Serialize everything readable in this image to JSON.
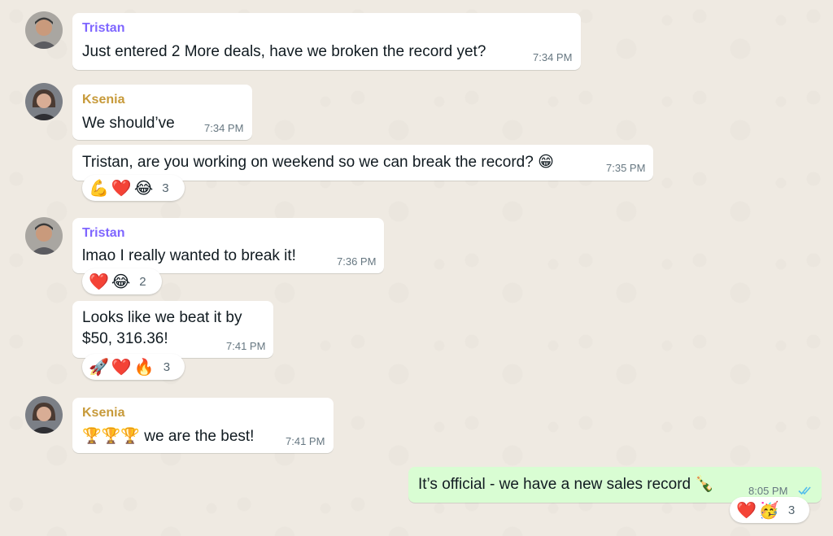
{
  "colors": {
    "background": "#efeae2",
    "incoming_bubble": "#ffffff",
    "outgoing_bubble": "#d9fdd3",
    "tristan_name": "#7f66ff",
    "ksenia_name": "#c79a3a",
    "read_ticks": "#53bdeb"
  },
  "messages": [
    {
      "sender": "Tristan",
      "text": "Just entered 2 More deals, have we broken the record yet?",
      "time": "7:34 PM"
    },
    {
      "sender": "Ksenia",
      "text": "We should’ve",
      "time": "7:34 PM"
    },
    {
      "text": "Tristan, are you working on weekend so we can break the record? 😁",
      "time": "7:35 PM",
      "reactions": {
        "emojis": [
          "💪",
          "❤️",
          "😂"
        ],
        "count": "3"
      }
    },
    {
      "sender": "Tristan",
      "text": "lmao I really wanted to break it!",
      "time": "7:36 PM",
      "reactions": {
        "emojis": [
          "❤️",
          "😂"
        ],
        "count": "2"
      }
    },
    {
      "text_line1": "Looks like we beat it by",
      "text_line2": "$50, 316.36!",
      "time": "7:41 PM",
      "reactions": {
        "emojis": [
          "🚀",
          "❤️",
          "🔥"
        ],
        "count": "3"
      }
    },
    {
      "sender": "Ksenia",
      "emojis": "🏆🏆🏆",
      "text": " we are the best!",
      "time": "7:41 PM"
    },
    {
      "text": "It’s official - we have a new sales record 🍾",
      "time": "8:05 PM",
      "status": "read",
      "reactions": {
        "emojis": [
          "❤️",
          "🥳"
        ],
        "count": "3"
      }
    }
  ]
}
